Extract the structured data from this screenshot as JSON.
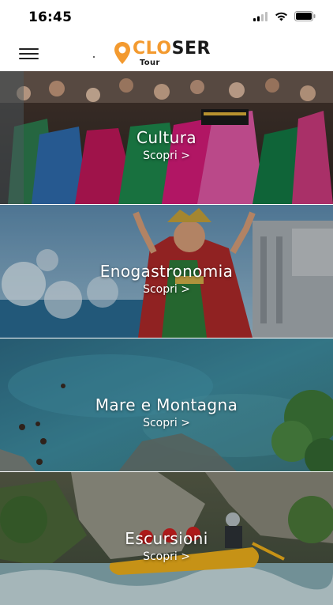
{
  "status_bar": {
    "time": "16:45",
    "icons": [
      "signal-icon",
      "wifi-icon",
      "battery-icon"
    ]
  },
  "header": {
    "menu_icon": "hamburger-menu-icon",
    "logo": {
      "accent_text": "CLO",
      "dark_text": "SER",
      "subtitle": "Tour",
      "accent_color": "#f39a2f"
    }
  },
  "categories": [
    {
      "title": "Cultura",
      "link": "Scopri >"
    },
    {
      "title": "Enogastronomia",
      "link": "Scopri >"
    },
    {
      "title": "Mare e Montagna",
      "link": "Scopri >"
    },
    {
      "title": "Escursioni",
      "link": "Scopri >"
    }
  ]
}
